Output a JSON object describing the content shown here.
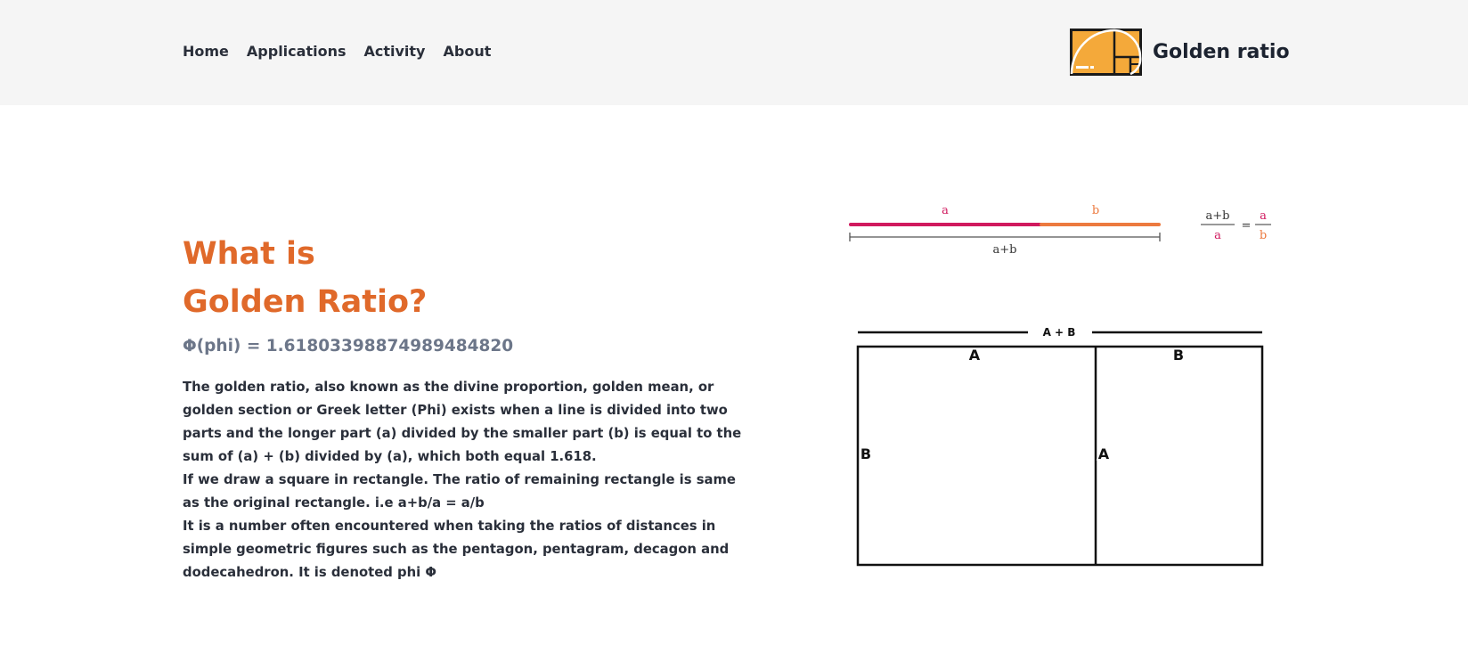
{
  "nav": {
    "items": [
      "Home",
      "Applications",
      "Activity",
      "About"
    ]
  },
  "brand": {
    "name": "Golden ratio",
    "logo_icon": "golden-spiral-logo",
    "logo_color": "#f4a93a"
  },
  "hero": {
    "title_line1": "What is",
    "title_line2": "Golden Ratio?",
    "phi": "Φ(phi) = 1.61803398874989484820",
    "paragraphs": [
      "The golden ratio, also known as the divine proportion, golden mean, or golden section or Greek letter (Phi) exists when a line is divided into two parts and the longer part (a) divided by the smaller part (b) is equal to the sum of (a) + (b) divided by (a), which both equal 1.618.",
      "If we draw a square in rectangle. The ratio of remaining rectangle is same as the original rectangle. i.e a+b/a = a/b",
      "It is a number often encountered when taking the ratios of distances in simple geometric figures such as the pentagon, pentagram, decagon and dodecahedron. It is denoted phi Φ"
    ]
  },
  "line_diagram": {
    "label_a": "a",
    "label_b": "b",
    "label_total": "a+b",
    "formula_num_left": "a+b",
    "formula_den_left": "a",
    "formula_equals": "=",
    "formula_num_right": "a",
    "formula_den_right": "b",
    "color_a": "#d0195e",
    "color_b": "#ec7a3f"
  },
  "rect_diagram": {
    "top_label": "A + B",
    "label_top_left": "A",
    "label_top_right": "B",
    "label_left_side": "B",
    "label_middle_side": "A"
  },
  "colors": {
    "accent": "#e0692a",
    "header_bg": "#f5f5f5",
    "phi_text": "#6c7689"
  }
}
